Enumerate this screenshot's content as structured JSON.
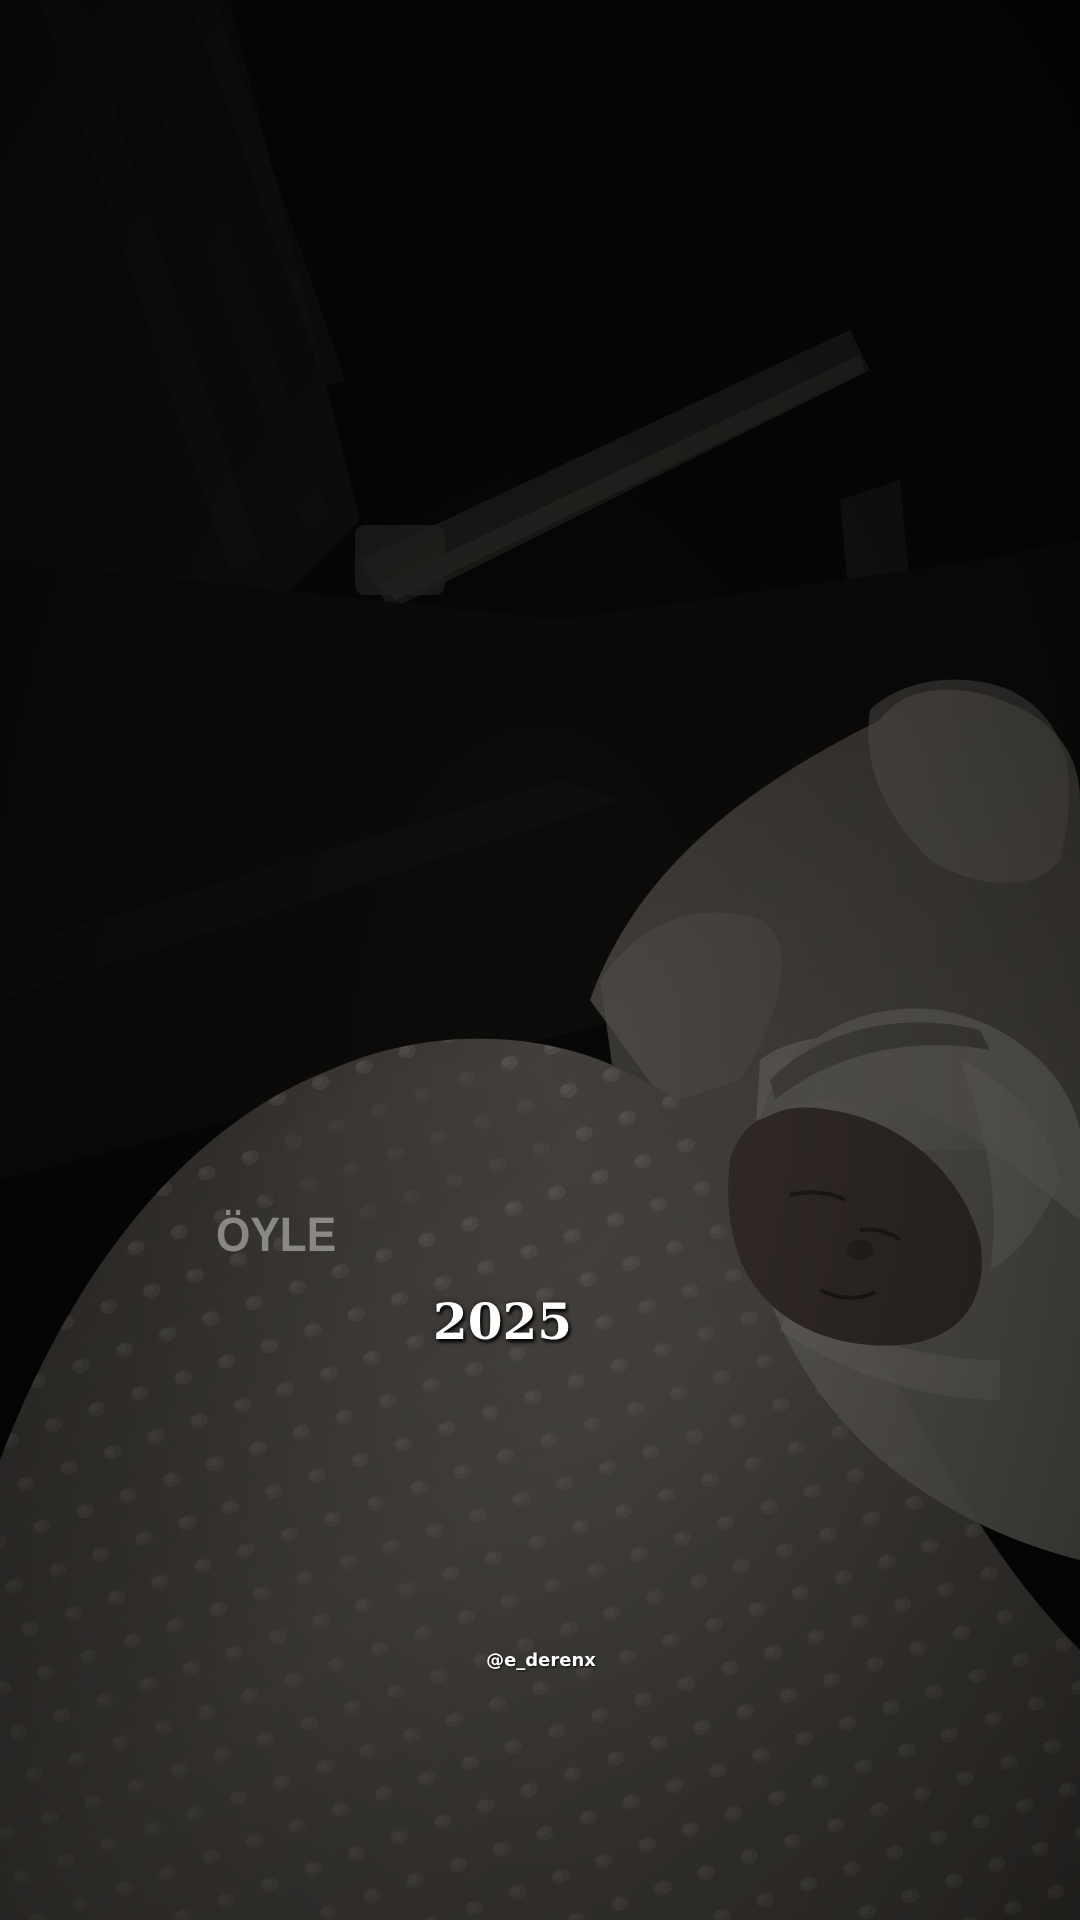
{
  "photo": {
    "subject": "sleeping-newborn-photo",
    "palette": {
      "background": "#0c0b0a",
      "blanket": "#6f6962",
      "hat": "#8c8983",
      "skin": "#4a3f39"
    }
  },
  "overlay": {
    "watermark": "ÖYLE",
    "year": "2025",
    "handle": "@e_derenx"
  }
}
